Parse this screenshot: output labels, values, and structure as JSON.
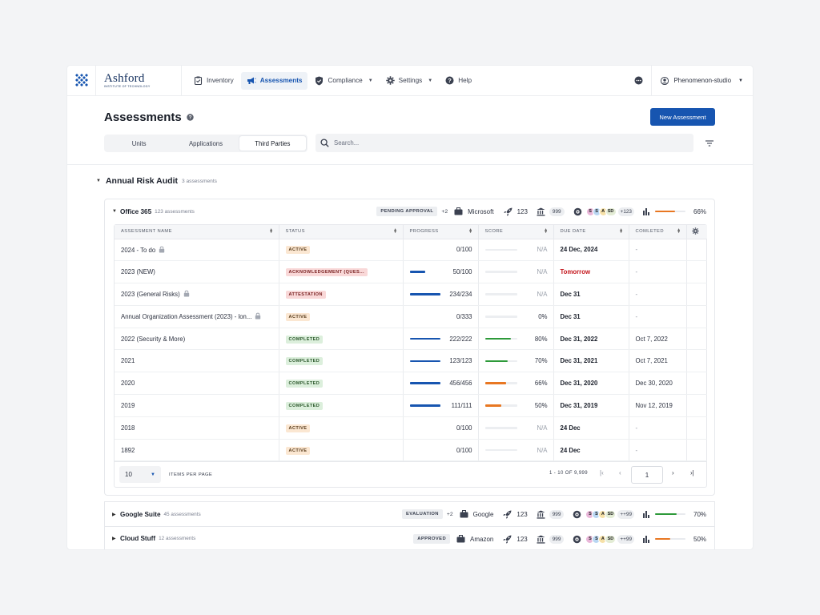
{
  "brand": {
    "name": "Ashford",
    "subtitle": "INSTITUTE OF TECHNOLOGY"
  },
  "nav": [
    {
      "label": "Inventory",
      "icon": "clipboard-icon",
      "active": false,
      "caret": false
    },
    {
      "label": "Assessments",
      "icon": "megaphone-icon",
      "active": true,
      "caret": false
    },
    {
      "label": "Compliance",
      "icon": "shield-check-icon",
      "active": false,
      "caret": true
    },
    {
      "label": "Settings",
      "icon": "gear-icon",
      "active": false,
      "caret": true
    },
    {
      "label": "Help",
      "icon": "help-circle-icon",
      "active": false,
      "caret": false
    }
  ],
  "user": {
    "name": "Phenomenon-studio"
  },
  "page": {
    "title": "Assessments",
    "new_button": "New Assessment"
  },
  "tabs": {
    "items": [
      "Units",
      "Applications",
      "Third Parties"
    ],
    "active": "Third Parties"
  },
  "search": {
    "placeholder": "Search..."
  },
  "group": {
    "name": "Annual Risk Audit",
    "count": "3 assessments"
  },
  "vendors": [
    {
      "name": "Office 365",
      "count": "123 assessments",
      "expanded": true,
      "badge": "PENDING APPROVAL",
      "extra": "+2",
      "vendor": "Microsoft",
      "rockets": "123",
      "bank": "999",
      "avatars": [
        "S",
        "S",
        "A",
        "SD"
      ],
      "avatar_more": "+123",
      "score_pct": 66,
      "score_label": "66%",
      "score_color": "#e87722"
    },
    {
      "name": "Google Suite",
      "count": "45 assessments",
      "expanded": false,
      "badge": "EVALUATION",
      "extra": "+2",
      "vendor": "Google",
      "rockets": "123",
      "bank": "999",
      "avatars": [
        "S",
        "S",
        "A",
        "SD"
      ],
      "avatar_more": "++99",
      "score_pct": 70,
      "score_label": "70%",
      "score_color": "#2e9a3a"
    },
    {
      "name": "Cloud Stuff",
      "count": "12 assessments",
      "expanded": false,
      "badge": "APPROVED",
      "extra": "",
      "vendor": "Amazon",
      "rockets": "123",
      "bank": "999",
      "avatars": [
        "S",
        "S",
        "A",
        "SD"
      ],
      "avatar_more": "++99",
      "score_pct": 50,
      "score_label": "50%",
      "score_color": "#e87722"
    }
  ],
  "table": {
    "headers": [
      "ASSESSMENT NAME",
      "STATUS",
      "PROGRESS",
      "SCORE",
      "DUE DATE",
      "COMLETED"
    ],
    "rows": [
      {
        "name": "2024 - To do",
        "lock": true,
        "status": "ACTIVE",
        "kind": "active",
        "progress": 0,
        "progress_label": "0/100",
        "score": null,
        "score_label": "N/A",
        "score_color": "",
        "due": "24 Dec, 2024",
        "due_red": false,
        "completed": "-"
      },
      {
        "name": "2023 (NEW)",
        "lock": false,
        "status": "ACKNOWLEDGEMENT (QUES...",
        "kind": "ack",
        "progress": 50,
        "progress_label": "50/100",
        "score": null,
        "score_label": "N/A",
        "score_color": "",
        "due": "Tomorrow",
        "due_red": true,
        "completed": "-"
      },
      {
        "name": "2023 (General Risks)",
        "lock": true,
        "status": "ATTESTATION",
        "kind": "att",
        "progress": 100,
        "progress_label": "234/234",
        "score": null,
        "score_label": "N/A",
        "score_color": "",
        "due": "Dec 31",
        "due_red": false,
        "completed": "-"
      },
      {
        "name": "Annual Organization Assessment (2023) - lon...",
        "lock": true,
        "status": "ACTIVE",
        "kind": "active",
        "progress": 0,
        "progress_label": "0/333",
        "score": 0,
        "score_label": "0%",
        "score_color": "",
        "due": "Dec 31",
        "due_red": false,
        "completed": "-"
      },
      {
        "name": "2022 (Security & More)",
        "lock": false,
        "status": "COMPLETED",
        "kind": "comp",
        "progress": 100,
        "progress_label": "222/222",
        "score": 80,
        "score_label": "80%",
        "score_color": "#2e9a3a",
        "due": "Dec 31, 2022",
        "due_red": false,
        "completed": "Oct 7, 2022"
      },
      {
        "name": "2021",
        "lock": false,
        "status": "COMPLETED",
        "kind": "comp",
        "progress": 100,
        "progress_label": "123/123",
        "score": 70,
        "score_label": "70%",
        "score_color": "#2e9a3a",
        "due": "Dec 31, 2021",
        "due_red": false,
        "completed": "Oct 7, 2021"
      },
      {
        "name": "2020",
        "lock": false,
        "status": "COMPLETED",
        "kind": "comp",
        "progress": 100,
        "progress_label": "456/456",
        "score": 66,
        "score_label": "66%",
        "score_color": "#e87722",
        "due": "Dec 31, 2020",
        "due_red": false,
        "completed": "Dec 30, 2020"
      },
      {
        "name": "2019",
        "lock": false,
        "status": "COMPLETED",
        "kind": "comp",
        "progress": 100,
        "progress_label": "111/111",
        "score": 50,
        "score_label": "50%",
        "score_color": "#e87722",
        "due": "Dec 31, 2019",
        "due_red": false,
        "completed": "Nov 12, 2019"
      },
      {
        "name": "2018",
        "lock": false,
        "status": "ACTIVE",
        "kind": "active",
        "progress": 0,
        "progress_label": "0/100",
        "score": null,
        "score_label": "N/A",
        "score_color": "",
        "due": "24 Dec",
        "due_red": false,
        "completed": "-"
      },
      {
        "name": "1892",
        "lock": false,
        "status": "ACTIVE",
        "kind": "active",
        "progress": 0,
        "progress_label": "0/100",
        "score": null,
        "score_label": "N/A",
        "score_color": "",
        "due": "24 Dec",
        "due_red": false,
        "completed": "-"
      }
    ]
  },
  "pagination": {
    "per_page": "10",
    "per_page_label": "ITEMS PER PAGE",
    "range": "1 - 10 OF 9,999",
    "page": "1"
  },
  "avatar_colors": [
    "#e9b7d9",
    "#b9d6f2",
    "#f6e1a8",
    "#e3ecd5"
  ]
}
